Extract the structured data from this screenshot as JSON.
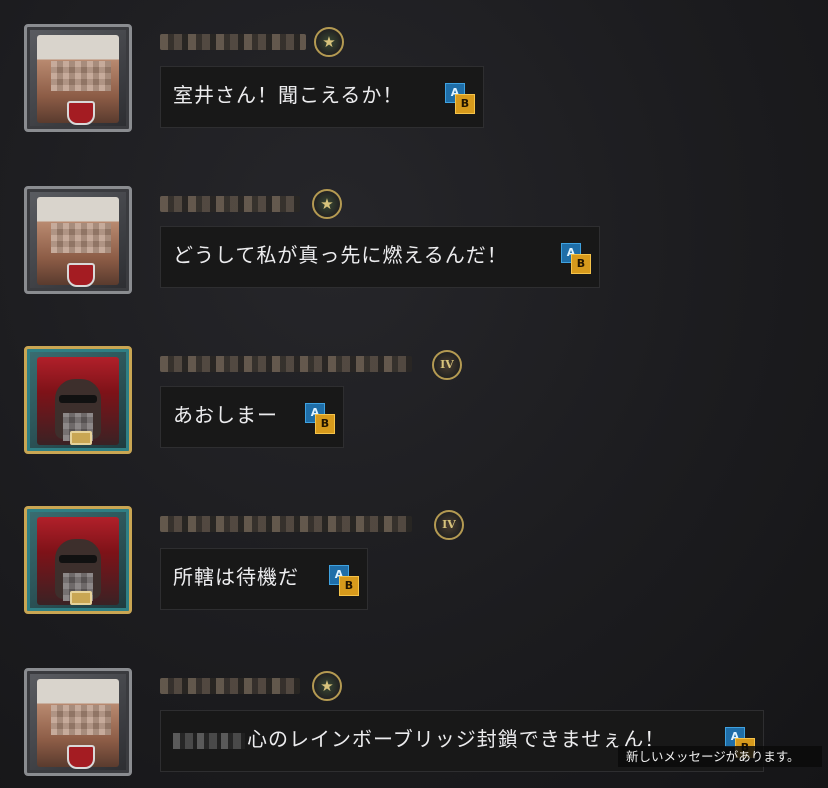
{
  "messages": [
    {
      "avatar": "soldier-headband",
      "rank_badge": "star",
      "text": "室井さん！聞こえるか！"
    },
    {
      "avatar": "soldier-headband",
      "rank_badge": "star",
      "text": "どうして私が真っ先に燃えるんだ！"
    },
    {
      "avatar": "red-hood-sunglasses",
      "rank_badge": "IV",
      "text": "あおしまー"
    },
    {
      "avatar": "red-hood-sunglasses",
      "rank_badge": "IV",
      "text": "所轄は待機だ"
    },
    {
      "avatar": "soldier-headband",
      "rank_badge": "star",
      "text": "心のレインボーブリッジ封鎖できませぇん！"
    }
  ],
  "translate_icon": {
    "a": "A",
    "b": "B"
  },
  "notification": {
    "text": "新しいメッセージがあります。"
  },
  "colors": {
    "background": "#1c1c1f",
    "bubble": "#181818",
    "translate_a": "#1f6ea8",
    "translate_b": "#d79a1c",
    "gold_frame": "#c9a653"
  }
}
